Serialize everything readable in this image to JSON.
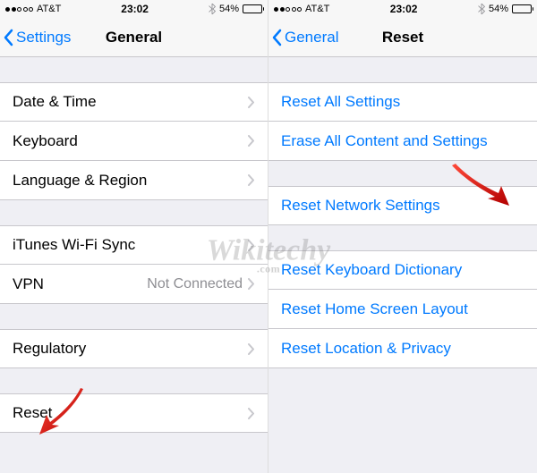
{
  "status": {
    "carrier": "AT&T",
    "time": "23:02",
    "battery_pct": "54%"
  },
  "left": {
    "back_label": "Settings",
    "title": "General",
    "groups": [
      {
        "items": [
          {
            "label": "Date & Time"
          },
          {
            "label": "Keyboard"
          },
          {
            "label": "Language & Region"
          }
        ]
      },
      {
        "items": [
          {
            "label": "iTunes Wi-Fi Sync"
          },
          {
            "label": "VPN",
            "value": "Not Connected"
          }
        ]
      },
      {
        "items": [
          {
            "label": "Regulatory"
          }
        ]
      },
      {
        "items": [
          {
            "label": "Reset"
          }
        ]
      }
    ]
  },
  "right": {
    "back_label": "General",
    "title": "Reset",
    "groups": [
      {
        "items": [
          {
            "label": "Reset All Settings"
          },
          {
            "label": "Erase All Content and Settings"
          }
        ]
      },
      {
        "items": [
          {
            "label": "Reset Network Settings"
          }
        ]
      },
      {
        "items": [
          {
            "label": "Reset Keyboard Dictionary"
          },
          {
            "label": "Reset Home Screen Layout"
          },
          {
            "label": "Reset Location & Privacy"
          }
        ]
      }
    ]
  },
  "watermark": {
    "text": "Wikitechy",
    "sub": ".com"
  }
}
